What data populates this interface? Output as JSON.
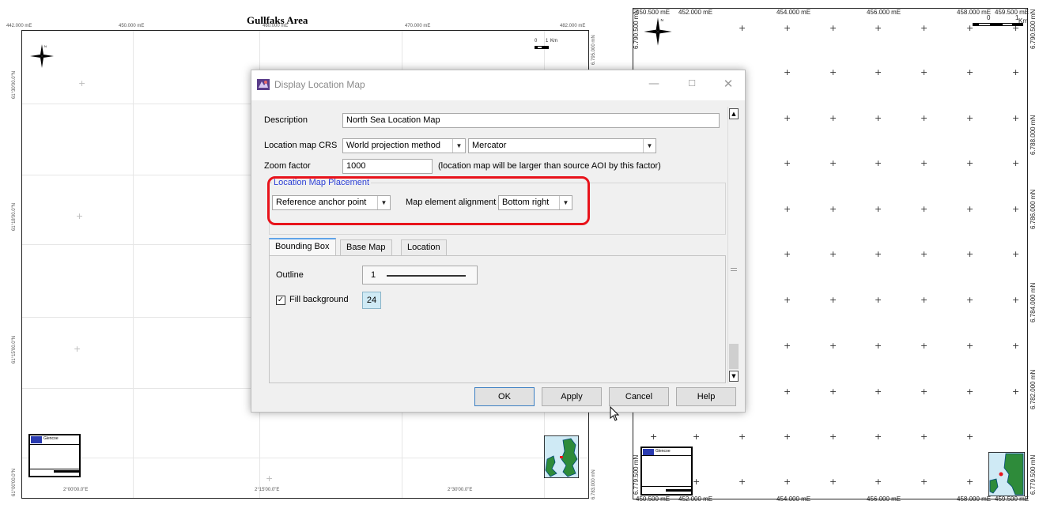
{
  "left_map": {
    "title": "Gullfaks Area",
    "top_eastings": [
      "442.000 mE",
      "450.000 mE",
      "460.000 mE",
      "470.000 mE",
      "482.000 mE"
    ],
    "left_latitudes": [
      "61°30'00.0\"N",
      "61°18'00.0\"N",
      "61°15'00.0\"N",
      "61°00'00.0\"N"
    ],
    "bottom_longitudes": [
      "2°00'00.0\"E",
      "2°15'00.0\"E",
      "2°30'00.0\"E"
    ],
    "right_northings": [
      "6.795.000 mN",
      "6.783.000 mN"
    ],
    "scale_bar": {
      "start": "0",
      "end": "1",
      "unit": "Km"
    },
    "logo_text": "Glencoe"
  },
  "right_map": {
    "top_eastings": [
      "450.500 mE",
      "452.000 mE",
      "454.000 mE",
      "456.000 mE",
      "458.000 mE",
      "459.500 mE"
    ],
    "bottom_eastings": [
      "450.500 mE",
      "452.000 mE",
      "454.000 mE",
      "456.000 mE",
      "458.000 mE",
      "459.500 mE"
    ],
    "left_northings": [
      "6.790.500 mN",
      "6.779.500 mN"
    ],
    "right_northings": [
      "6.790.500 mN",
      "6.788.000 mN",
      "6.786.000 mN",
      "6.784.000 mN",
      "6.782.000 mN",
      "6.779.500 mN"
    ],
    "scale_bar": {
      "start": "0",
      "end": "1",
      "unit": "Km"
    },
    "logo_text": "Glencoe"
  },
  "dialog": {
    "title": "Display Location Map",
    "description_label": "Description",
    "description_value": "North Sea Location Map",
    "crs_label": "Location map CRS",
    "crs_method": "World projection method",
    "crs_projection": "Mercator",
    "zoom_label": "Zoom factor",
    "zoom_value": "1000",
    "zoom_hint": "(location map will be larger than source AOI by this factor)",
    "placement_legend": "Location Map Placement",
    "anchor_value": "Reference anchor point",
    "alignment_label": "Map element alignment",
    "alignment_value": "Bottom right",
    "tabs": [
      {
        "label": "Bounding Box",
        "active": true
      },
      {
        "label": "Base Map",
        "active": false
      },
      {
        "label": "Location",
        "active": false
      }
    ],
    "outline_label": "Outline",
    "outline_value": "1",
    "fill_label": "Fill background",
    "fill_checked": true,
    "fill_value": "24",
    "buttons": {
      "ok": "OK",
      "apply": "Apply",
      "cancel": "Cancel",
      "help": "Help"
    }
  },
  "colors": {
    "highlight": "#e8131b",
    "legend_blue": "#2c3fd6",
    "tab_accent": "#5fa3e8",
    "swatch": "#cfeaf5"
  }
}
